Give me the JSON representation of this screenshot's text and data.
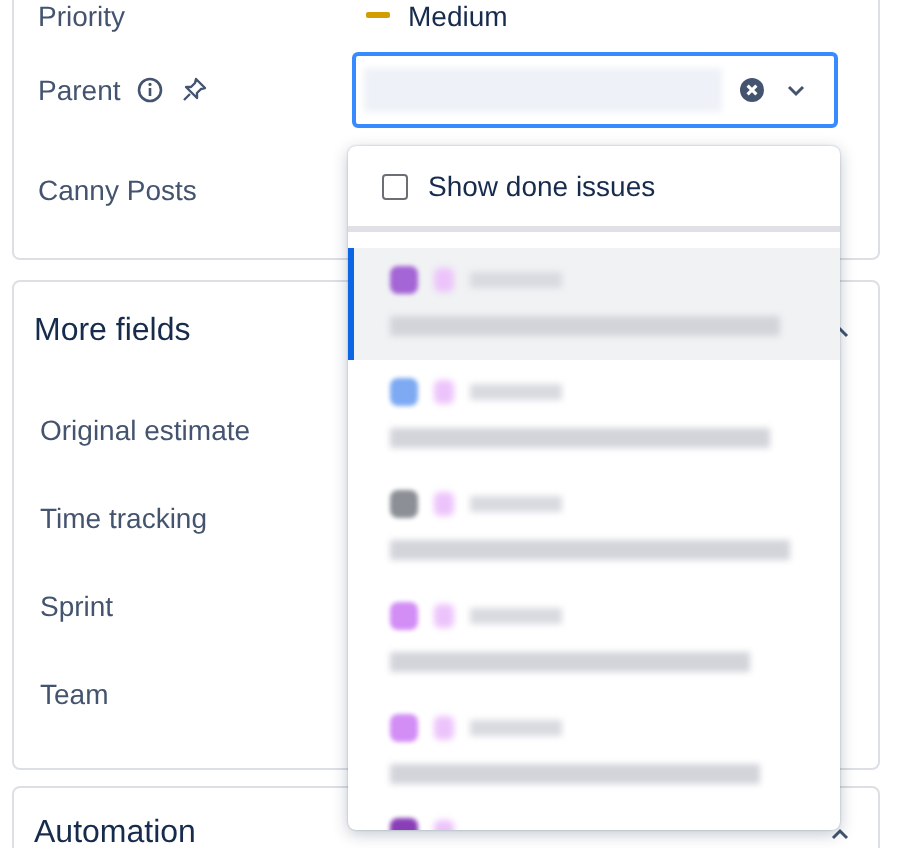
{
  "details": {
    "fields": [
      {
        "label": "Priority",
        "kind": "priority",
        "value": "Medium"
      },
      {
        "label": "Parent",
        "kind": "parent",
        "info": true,
        "pinned": false
      },
      {
        "label": "Canny Posts",
        "kind": "empty"
      }
    ]
  },
  "more_fields": {
    "title": "More fields",
    "expanded": true,
    "fields": [
      "Original estimate",
      "Time tracking",
      "Sprint",
      "Team"
    ]
  },
  "automation": {
    "title": "Automation",
    "expanded": true
  },
  "dropdown": {
    "show_done": {
      "label": "Show done issues",
      "checked": false
    },
    "items": [
      {
        "color": "#a465d6",
        "selected": true
      },
      {
        "color": "#7eaaf3",
        "selected": false
      },
      {
        "color": "#8c8f96",
        "selected": false
      },
      {
        "color": "#d38ef6",
        "selected": false
      },
      {
        "color": "#d38ef6",
        "selected": false
      },
      {
        "color": "#8a3fb8",
        "selected": false,
        "cut_off": true
      }
    ]
  }
}
